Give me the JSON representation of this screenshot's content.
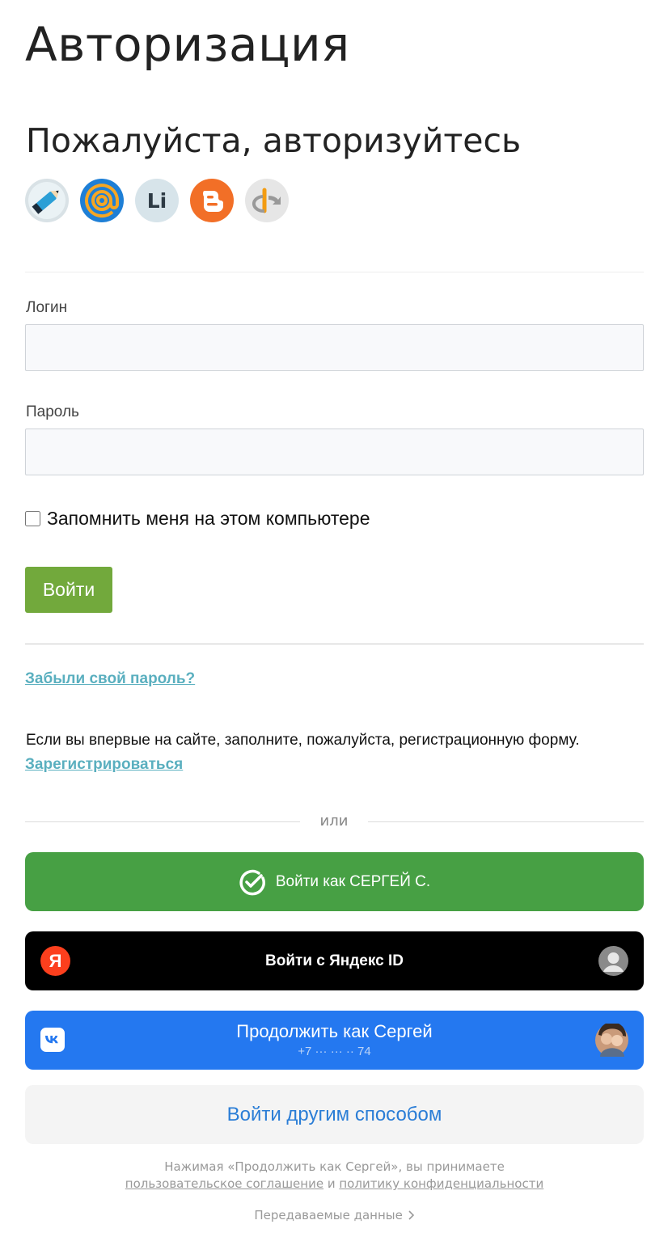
{
  "page": {
    "title": "Авторизация",
    "subtitle": "Пожалуйста, авторизуйтесь"
  },
  "providers": [
    {
      "name": "livejournal-icon",
      "color": "#d9e2e6"
    },
    {
      "name": "mail-ru-icon",
      "color": "#1e7fd6"
    },
    {
      "name": "liveinternet-icon",
      "color": "#d7e4ea",
      "glyph": "Li"
    },
    {
      "name": "blogger-icon",
      "color": "#f26f27"
    },
    {
      "name": "openid-icon",
      "color": "#e6e6e6"
    }
  ],
  "form": {
    "login_label": "Логин",
    "login_value": "",
    "password_label": "Пароль",
    "password_value": "",
    "remember_label": "Запомнить меня на этом компьютере",
    "remember_checked": false,
    "submit_label": "Войти",
    "accent": "#72a93c"
  },
  "links": {
    "forgot": "Забыли свой пароль?",
    "register_note": "Если вы впервые на сайте, заполните, пожалуйста, регистрационную форму.",
    "register": "Зарегистрироваться",
    "color": "#5aafbf"
  },
  "divider_text": "или",
  "social": {
    "sber_label": "Войти как СЕРГЕЙ С.",
    "sber_color": "#47a044",
    "yandex_label": "Войти с Яндекс ID",
    "yandex_glyph": "Я",
    "vk_name": "Продолжить как Сергей",
    "vk_phone": "+7 ··· ··· ·· 74",
    "vk_color": "#2478f0",
    "other_label": "Войти другим способом"
  },
  "terms": {
    "prefix": "Нажимая «Продолжить как Сергей», вы принимаете",
    "agreement_link": "пользовательское соглашение",
    "conjunction": "и",
    "privacy_link": "политику конфиденциальности",
    "transfer": "Передаваемые данные"
  }
}
